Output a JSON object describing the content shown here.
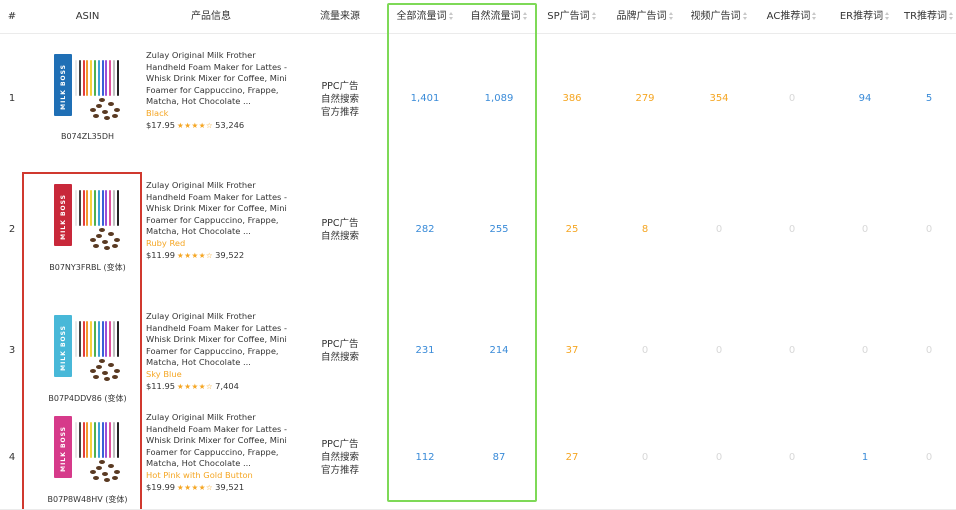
{
  "header": {
    "columns": [
      {
        "key": "idx",
        "label": "#",
        "sortable": false
      },
      {
        "key": "asin",
        "label": "ASIN",
        "sortable": false
      },
      {
        "key": "product",
        "label": "产品信息",
        "sortable": false
      },
      {
        "key": "source",
        "label": "流量来源",
        "sortable": false
      },
      {
        "key": "all_traffic",
        "label": "全部流量词",
        "sortable": true
      },
      {
        "key": "organic",
        "label": "自然流量词",
        "sortable": true
      },
      {
        "key": "sp",
        "label": "SP广告词",
        "sortable": true
      },
      {
        "key": "brand",
        "label": "品牌广告词",
        "sortable": true
      },
      {
        "key": "video",
        "label": "视频广告词",
        "sortable": true
      },
      {
        "key": "ac",
        "label": "AC推荐词",
        "sortable": true
      },
      {
        "key": "er",
        "label": "ER推荐词",
        "sortable": true
      },
      {
        "key": "tr",
        "label": "TR推荐词",
        "sortable": true
      }
    ]
  },
  "rows": [
    {
      "index": "1",
      "asin": "B074ZL35DH",
      "title": "Zulay Original Milk Frother Handheld Foam Maker for Lattes - Whisk Drink Mixer for Coffee, Mini Foamer for Cappuccino, Frappe, Matcha, Hot Chocolate ...",
      "variant": "Black",
      "price": "$17.95",
      "stars": "★★★★☆",
      "reviews": "53,246",
      "box_color": "#1f6fb5",
      "box_label": "MILK BOSS",
      "sources": [
        "PPC广告",
        "自然搜索",
        "官方推荐"
      ],
      "all_traffic": "1,401",
      "organic": "1,089",
      "sp": "386",
      "brand": "279",
      "video": "354",
      "ac": "0",
      "er": "94",
      "tr": "5"
    },
    {
      "index": "2",
      "asin": "B07NY3FRBL (变体)",
      "title": "Zulay Original Milk Frother Handheld Foam Maker for Lattes - Whisk Drink Mixer for Coffee, Mini Foamer for Cappuccino, Frappe, Matcha, Hot Chocolate ...",
      "variant": "Ruby Red",
      "price": "$11.99",
      "stars": "★★★★☆",
      "reviews": "39,522",
      "box_color": "#c8283a",
      "box_label": "MILK BOSS",
      "sources": [
        "PPC广告",
        "自然搜索"
      ],
      "all_traffic": "282",
      "organic": "255",
      "sp": "25",
      "brand": "8",
      "video": "0",
      "ac": "0",
      "er": "0",
      "tr": "0"
    },
    {
      "index": "3",
      "asin": "B07P4DDV86 (变体)",
      "title": "Zulay Original Milk Frother Handheld Foam Maker for Lattes - Whisk Drink Mixer for Coffee, Mini Foamer for Cappuccino, Frappe, Matcha, Hot Chocolate ...",
      "variant": "Sky Blue",
      "price": "$11.95",
      "stars": "★★★★☆",
      "reviews": "7,404",
      "box_color": "#48b8d8",
      "box_label": "MILK BOSS",
      "sources": [
        "PPC广告",
        "自然搜索"
      ],
      "all_traffic": "231",
      "organic": "214",
      "sp": "37",
      "brand": "0",
      "video": "0",
      "ac": "0",
      "er": "0",
      "tr": "0"
    },
    {
      "index": "4",
      "asin": "B07P8W48HV (变体)",
      "title": "Zulay Original Milk Frother Handheld Foam Maker for Lattes - Whisk Drink Mixer for Coffee, Mini Foamer for Cappuccino, Frappe, Matcha, Hot Chocolate ...",
      "variant": "Hot Pink with Gold Button",
      "price": "$19.99",
      "stars": "★★★★☆",
      "reviews": "39,521",
      "box_color": "#d63a8a",
      "box_label": "MILK BOSS",
      "sources": [
        "PPC广告",
        "自然搜索",
        "官方推荐"
      ],
      "all_traffic": "112",
      "organic": "87",
      "sp": "27",
      "brand": "0",
      "video": "0",
      "ac": "0",
      "er": "1",
      "tr": "0"
    }
  ],
  "colors": {
    "blue": "#3a8bd8",
    "orange": "#f5a623",
    "gray": "#d8d8d8",
    "highlight_green": "#7ed957",
    "highlight_red": "#d0392f"
  }
}
